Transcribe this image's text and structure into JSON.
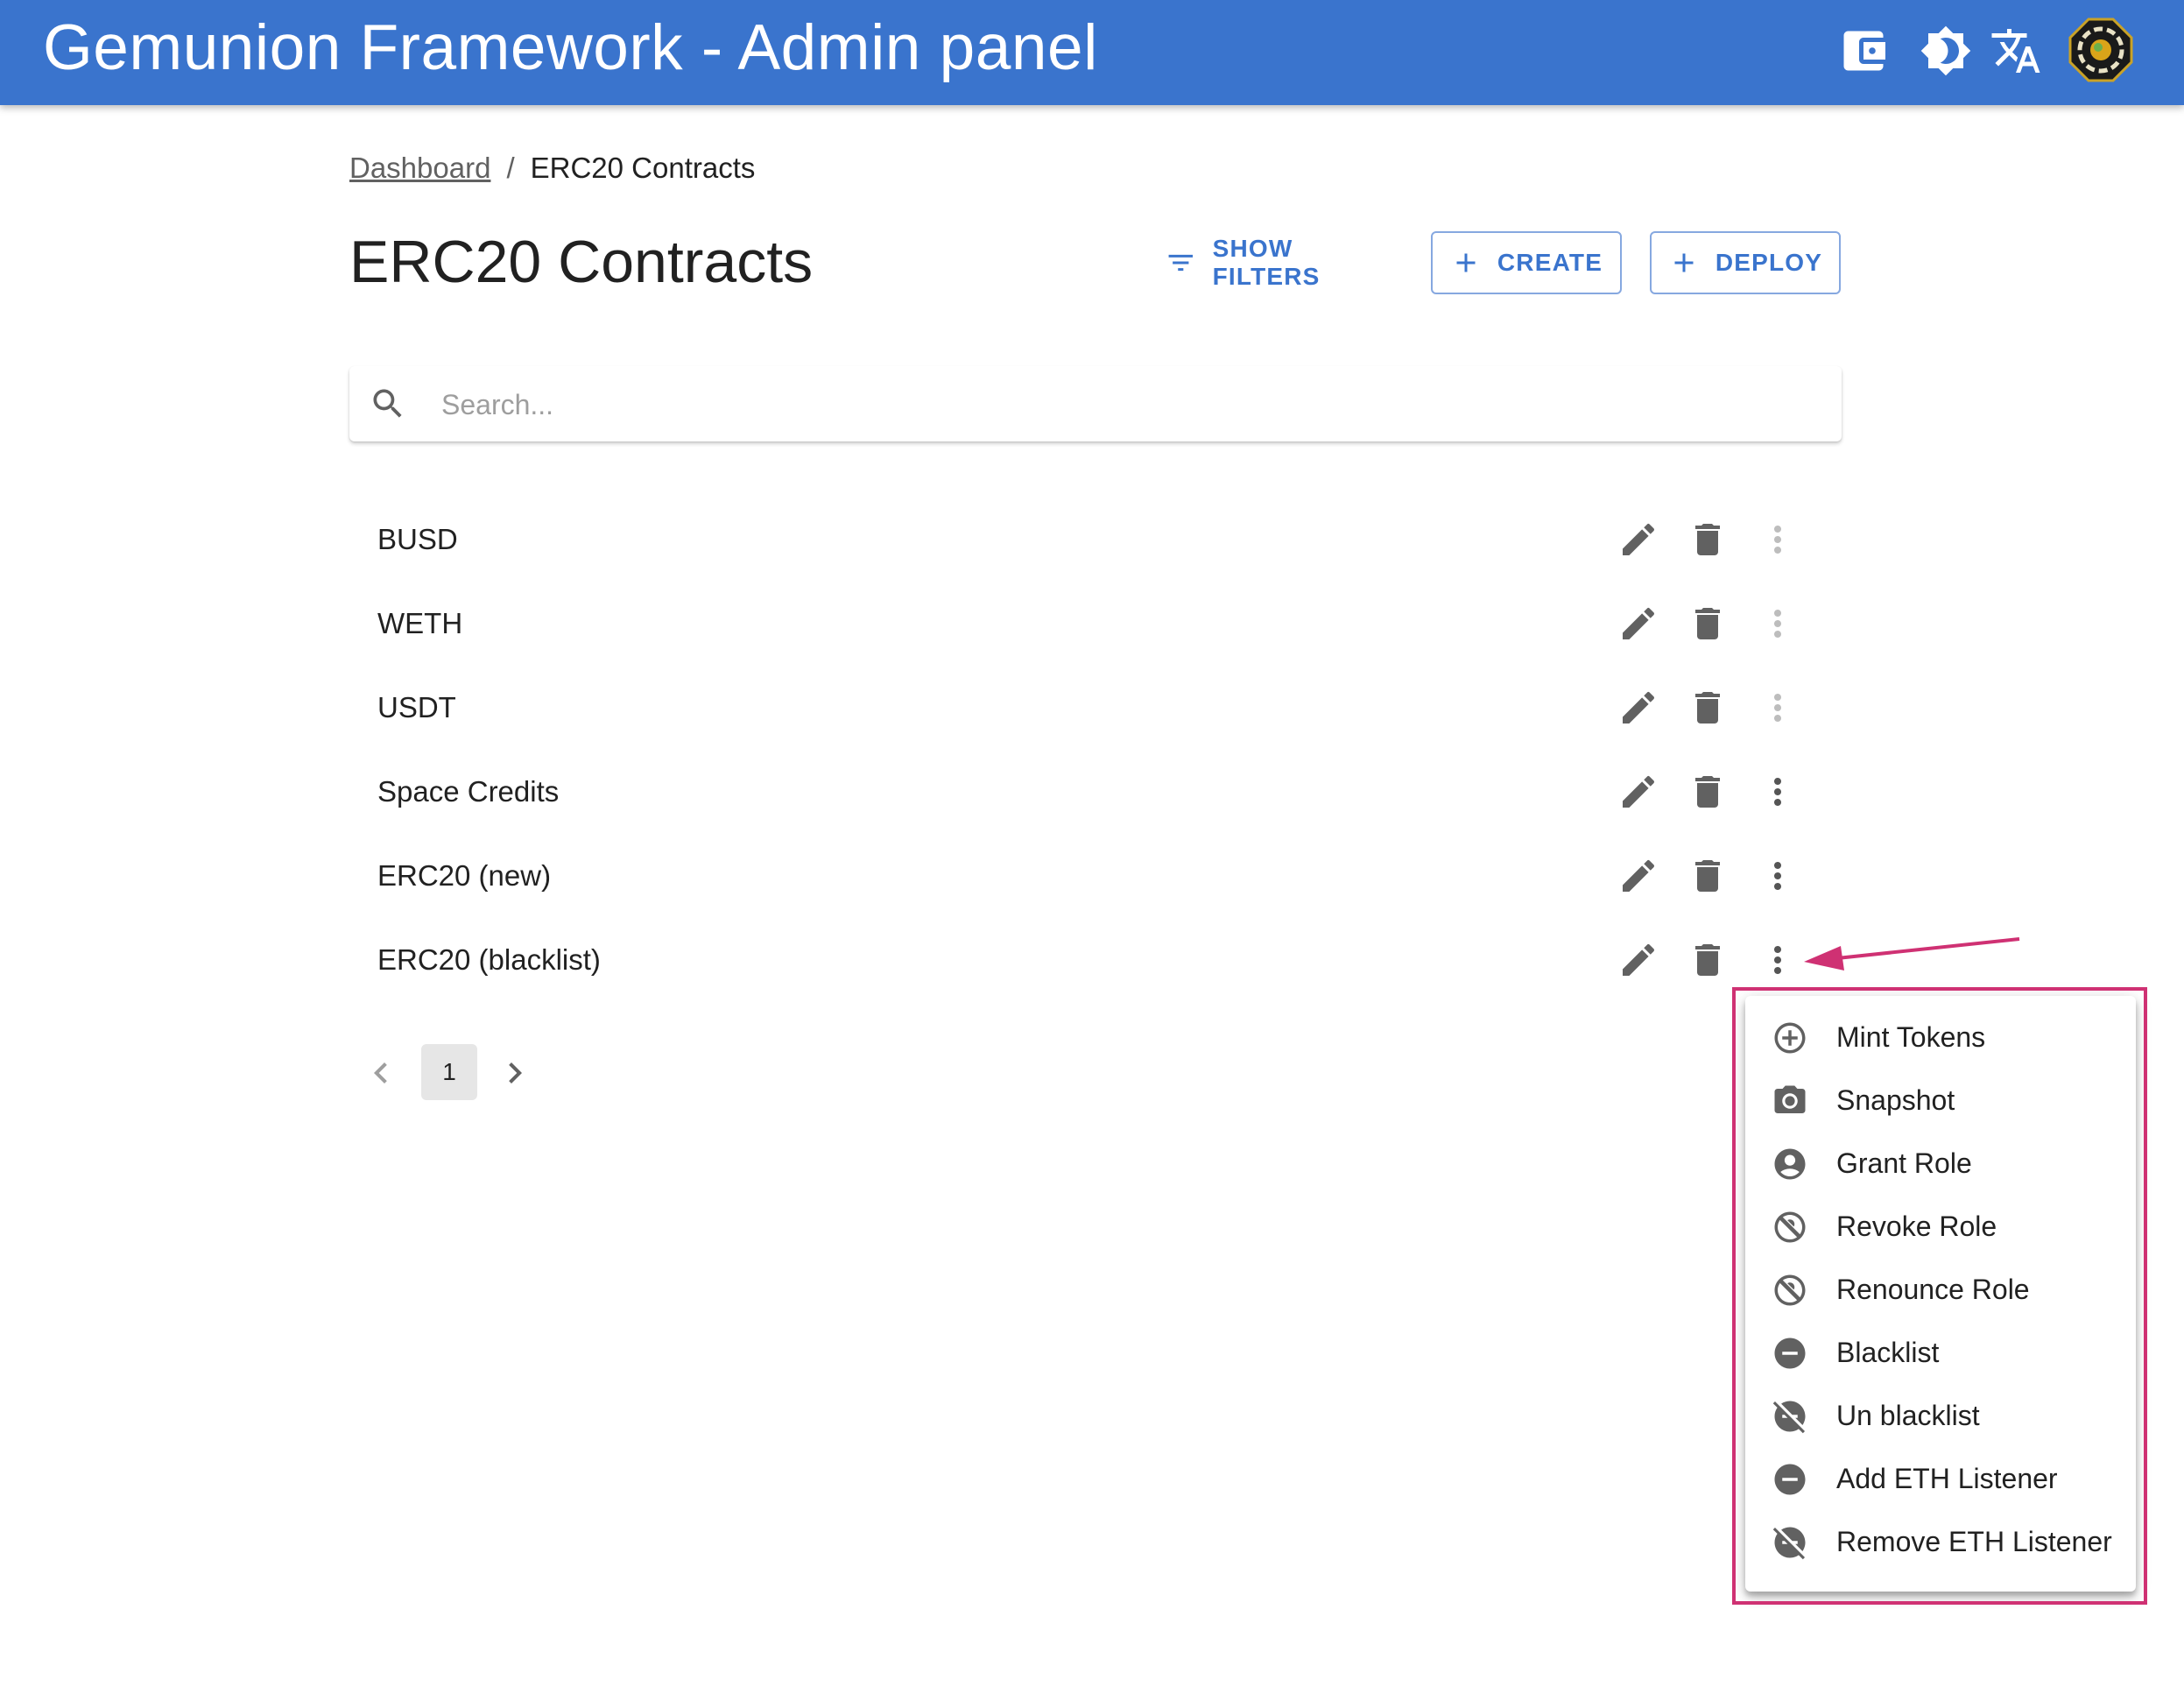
{
  "app": {
    "title": "Gemunion Framework - Admin panel",
    "toolbar_icons": [
      "wallet-icon",
      "theme-toggle-icon",
      "translate-icon",
      "user-avatar"
    ],
    "colors": {
      "primary": "#3a74cd",
      "highlight": "#cf3173"
    }
  },
  "breadcrumb": {
    "home": "Dashboard",
    "separator": "/",
    "current": "ERC20 Contracts"
  },
  "page": {
    "title": "ERC20 Contracts",
    "show_filters": "SHOW FILTERS",
    "create": "CREATE",
    "deploy": "DEPLOY"
  },
  "search": {
    "placeholder": "Search...",
    "value": ""
  },
  "contracts": [
    {
      "name": "BUSD",
      "more_enabled": false
    },
    {
      "name": "WETH",
      "more_enabled": false
    },
    {
      "name": "USDT",
      "more_enabled": false
    },
    {
      "name": "Space Credits",
      "more_enabled": true
    },
    {
      "name": "ERC20 (new)",
      "more_enabled": true
    },
    {
      "name": "ERC20 (blacklist)",
      "more_enabled": true
    }
  ],
  "pagination": {
    "current_page": "1"
  },
  "context_menu": {
    "items": [
      {
        "label": "Mint Tokens",
        "icon": "add-circle-outline-icon"
      },
      {
        "label": "Snapshot",
        "icon": "camera-icon"
      },
      {
        "label": "Grant Role",
        "icon": "account-circle-icon"
      },
      {
        "label": "Revoke Role",
        "icon": "no-accounts-icon"
      },
      {
        "label": "Renounce Role",
        "icon": "no-accounts-icon"
      },
      {
        "label": "Blacklist",
        "icon": "do-not-disturb-on-icon"
      },
      {
        "label": "Un blacklist",
        "icon": "do-not-disturb-off-icon"
      },
      {
        "label": "Add ETH Listener",
        "icon": "do-not-disturb-on-icon"
      },
      {
        "label": "Remove ETH Listener",
        "icon": "do-not-disturb-off-icon"
      }
    ]
  }
}
